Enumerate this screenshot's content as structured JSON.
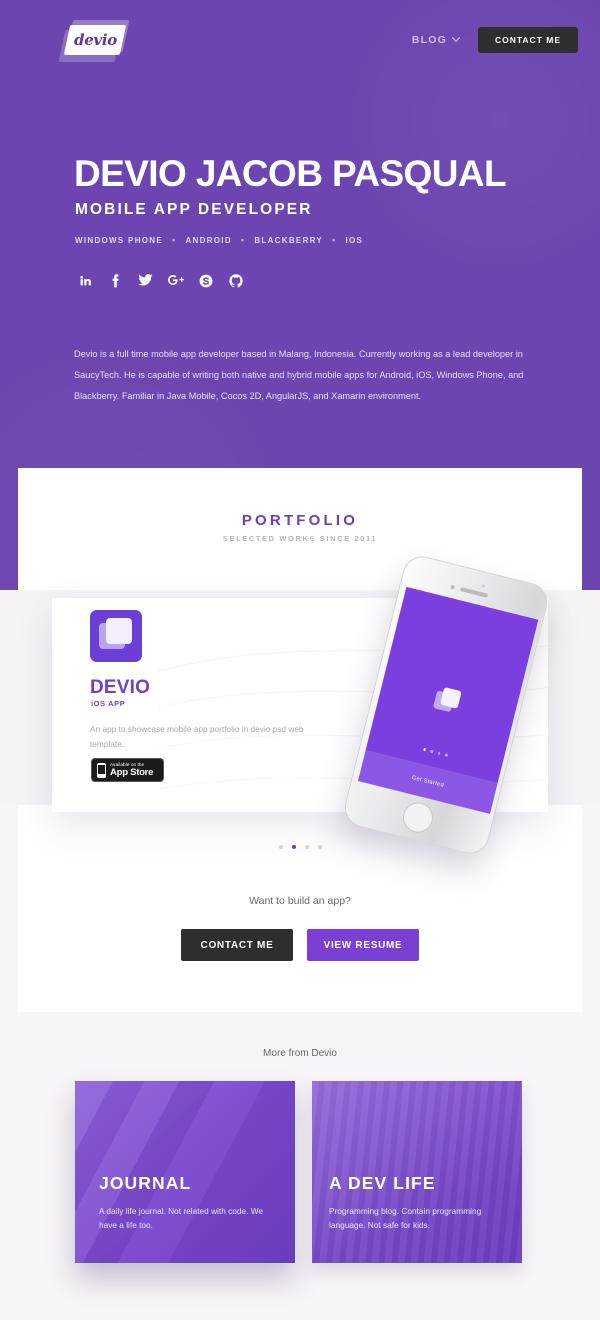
{
  "nav": {
    "logo_text": "devio",
    "blog_label": "BLOG",
    "chevron": "⌄",
    "contact_label": "CONTACT ME"
  },
  "hero": {
    "name": "DEVIO JACOB PASQUAL",
    "role": "MOBILE APP DEVELOPER",
    "tags": [
      "WINDOWS PHONE",
      "ANDROID",
      "BLACKBERRY",
      "IOS"
    ],
    "separator": "•",
    "socials": [
      {
        "name": "linkedin-icon",
        "label": "LinkedIn"
      },
      {
        "name": "facebook-icon",
        "label": "Facebook"
      },
      {
        "name": "twitter-icon",
        "label": "Twitter"
      },
      {
        "name": "googleplus-icon",
        "label": "Google Plus"
      },
      {
        "name": "skype-icon",
        "label": "Skype"
      },
      {
        "name": "github-icon",
        "label": "GitHub"
      }
    ],
    "bio": "Devio is a full time mobile app developer based in Malang, Indonesia. Currently working as a lead developer in SaucyTech. He is capable of writing both native and hybrid mobile apps for Android, iOS, Windows Phone, and Blackberry. Familiar in Java Mobile, Cocos 2D, AngularJS, and Xamarin environment."
  },
  "portfolio": {
    "title": "PORTFOLIO",
    "subtitle": "SELECTED WORKS SINCE 2011",
    "slide": {
      "heading": "DEVIO",
      "kicker": "iOS APP",
      "description": "An app to showcase mobile app portfolio in devio psd web template.",
      "appstore_line1": "Available on the",
      "appstore_line2": "App Store",
      "phone_button_label": "Get Started"
    },
    "carousel": {
      "count": 4,
      "active_index": 1
    }
  },
  "cta": {
    "question": "Want to build an app?",
    "contact_label": "CONTACT ME",
    "resume_label": "VIEW RESUME"
  },
  "more": {
    "title": "More from Devio",
    "cards": [
      {
        "heading": "JOURNAL",
        "description": "A daily life journal. Not related with code. We have a life too."
      },
      {
        "heading": "A DEV LIFE",
        "description": "Programming blog. Contain programming language. Not safe for kids."
      }
    ]
  },
  "colors": {
    "hero_purple": "#6b46b0",
    "accent_purple": "#7b3fd6",
    "title_purple": "#6b3fb5",
    "dark_button": "#2e2e30",
    "page_bg": "#f7f5f7"
  }
}
